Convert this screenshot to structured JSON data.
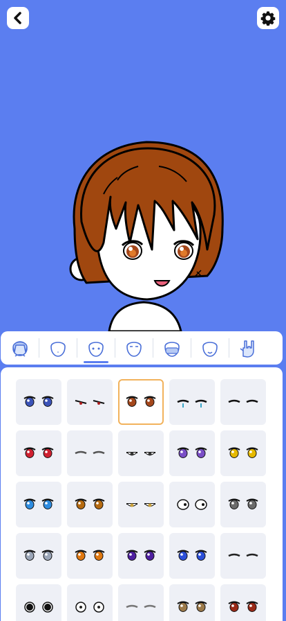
{
  "header": {
    "back_icon": "chevron-left-icon",
    "settings_icon": "gear-icon"
  },
  "colors": {
    "background": "#5b7ef0",
    "selected_border": "#f2b25c",
    "hair": "#a0470f",
    "cell_bg": "#eef0f6"
  },
  "categories": [
    {
      "name": "hair-category",
      "icon": "hair-head-icon",
      "active": false
    },
    {
      "name": "face-shape-category",
      "icon": "face-outline-icon",
      "active": false
    },
    {
      "name": "eyes-category",
      "icon": "face-eyes-icon",
      "active": true
    },
    {
      "name": "eyebrows-category",
      "icon": "face-eyebrows-icon",
      "active": false
    },
    {
      "name": "accessory-category",
      "icon": "face-mask-icon",
      "active": false
    },
    {
      "name": "mouth-category",
      "icon": "face-mouth-icon",
      "active": false
    },
    {
      "name": "pose-category",
      "icon": "rock-hand-icon",
      "active": false
    }
  ],
  "eye_options": [
    {
      "style": "blue-round",
      "color": "#3b53b8"
    },
    {
      "style": "angry-narrow",
      "color": "#b02020"
    },
    {
      "style": "brown-round",
      "color": "#a4471b",
      "selected": true
    },
    {
      "style": "crying-closed",
      "color": "#3aa6c8"
    },
    {
      "style": "closed-thick",
      "color": "#111111"
    },
    {
      "style": "red-sharp",
      "color": "#d02030"
    },
    {
      "style": "lined-closed",
      "color": "#555555"
    },
    {
      "style": "half-lid",
      "color": "#333333"
    },
    {
      "style": "purple-sparkle",
      "color": "#7a4ec6"
    },
    {
      "style": "yellow-cat",
      "color": "#e6b900"
    },
    {
      "style": "bright-blue",
      "color": "#2f8de0"
    },
    {
      "style": "amber-gradient",
      "color": "#b56a10"
    },
    {
      "style": "sleepy-white",
      "color": "#c9a13c"
    },
    {
      "style": "blank-round",
      "color": "#222222"
    },
    {
      "style": "gray-tired",
      "color": "#6b6b6b"
    },
    {
      "style": "white-pale",
      "color": "#9ba6b8"
    },
    {
      "style": "orange-gold",
      "color": "#e07810"
    },
    {
      "style": "purple-lash",
      "color": "#4e1fa0"
    },
    {
      "style": "deep-blue",
      "color": "#2b4fd8"
    },
    {
      "style": "cross-wink",
      "color": "#222222"
    },
    {
      "style": "black-dot",
      "color": "#111111"
    },
    {
      "style": "white-dot",
      "color": "#222222"
    },
    {
      "style": "gray-narrow",
      "color": "#777777"
    },
    {
      "style": "hazel-wide",
      "color": "#9c7a4a"
    },
    {
      "style": "red-brown",
      "color": "#9a2a18"
    }
  ]
}
